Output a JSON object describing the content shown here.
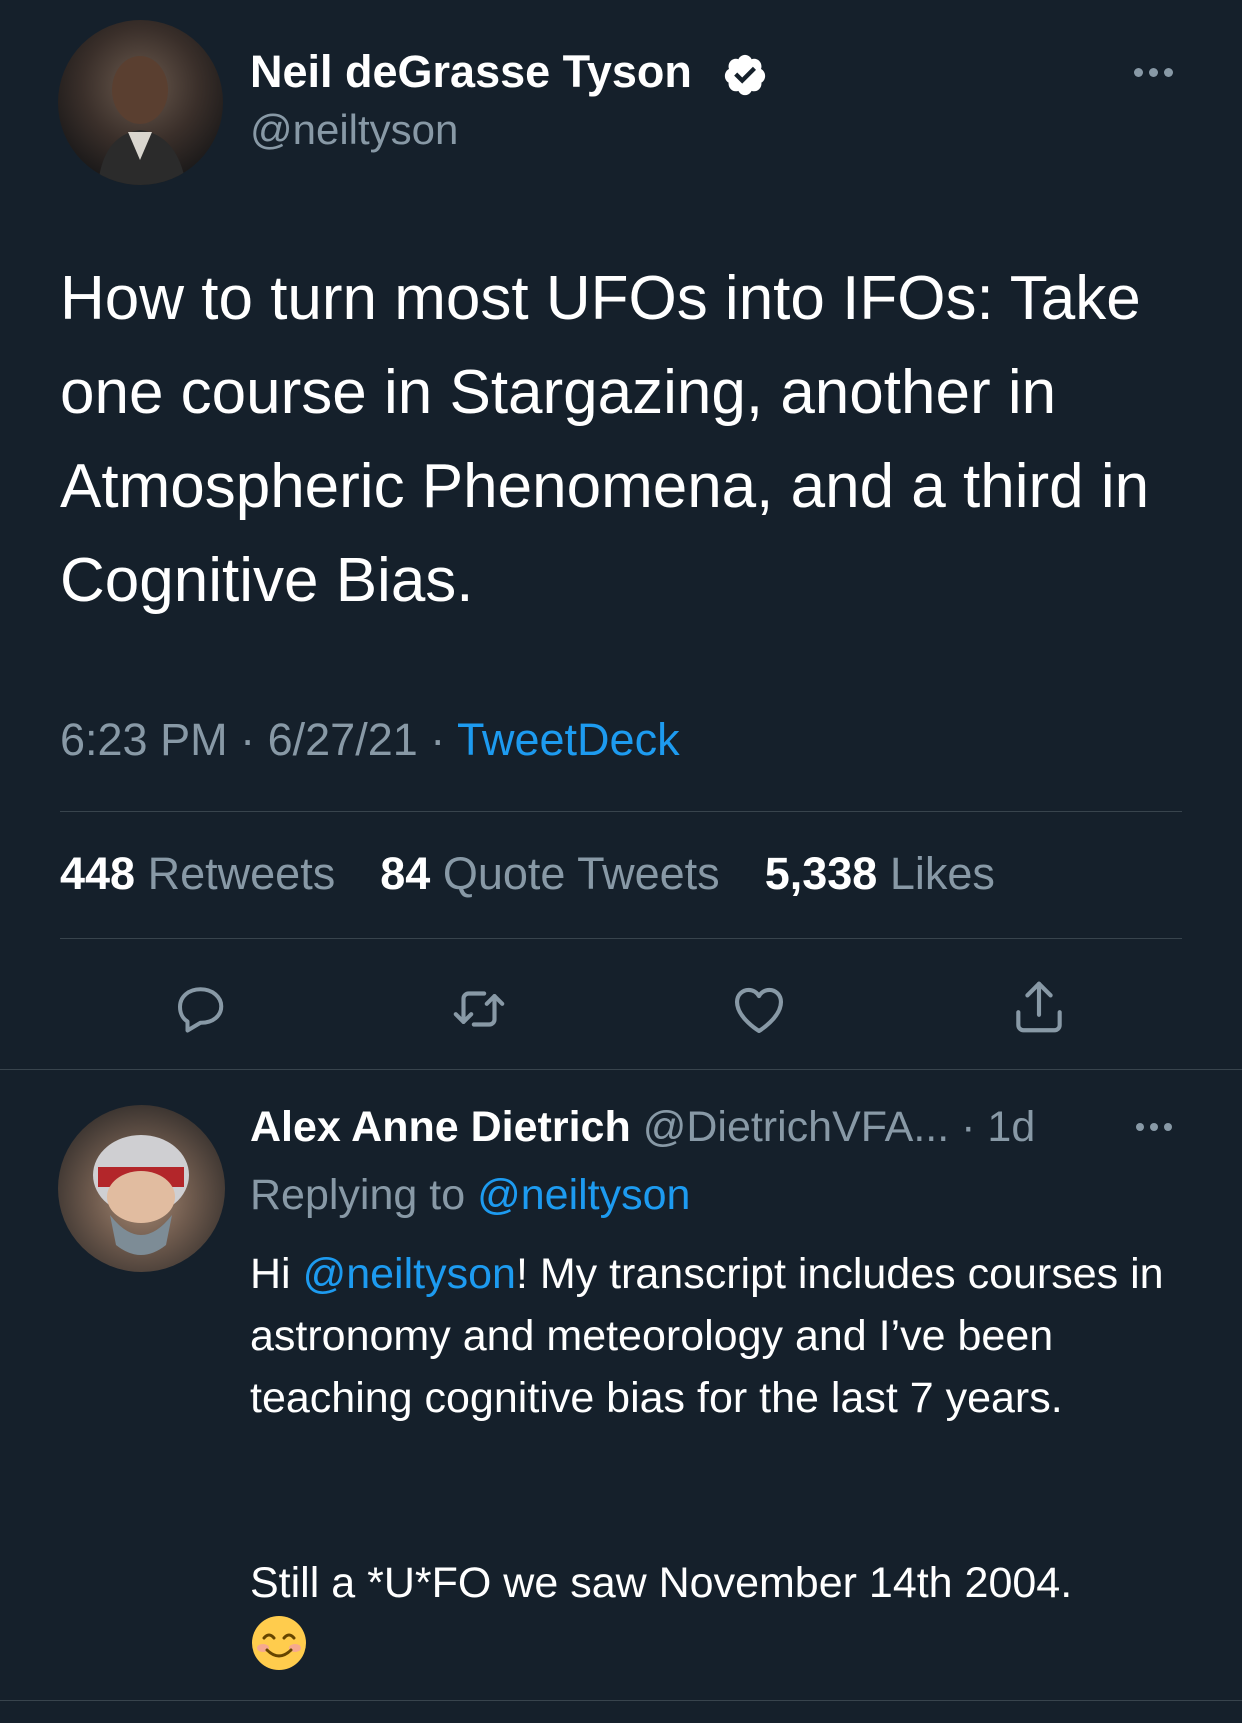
{
  "main_tweet": {
    "author_name": "Neil deGrasse Tyson",
    "handle": "@neiltyson",
    "text": "How to turn most UFOs into IFOs: Take one course in Stargazing, another in Atmospheric Phenomena, and a third in Cognitive Bias.",
    "time": "6:23 PM",
    "date": "6/27/21",
    "source": "TweetDeck",
    "separator": "·",
    "stats": {
      "retweets_count": "448",
      "retweets_label": "Retweets",
      "quotes_count": "84",
      "quotes_label": "Quote Tweets",
      "likes_count": "5,338",
      "likes_label": "Likes"
    }
  },
  "reply": {
    "author_name": "Alex Anne Dietrich",
    "handle": "@DietrichVFA...",
    "age": "· 1d",
    "replying_prefix": "Replying to",
    "replying_handle": "@neiltyson",
    "text_hi": "Hi ",
    "text_mention": "@neiltyson",
    "text_body": "! My transcript includes courses in astronomy and meteorology and I’ve been teaching cognitive bias for the last 7 years.",
    "text_second": "Still a *U*FO we saw November 14th 2004.",
    "emoji": "😊"
  },
  "colors": {
    "background": "#15202b",
    "accent": "#1d9bf0",
    "muted": "#8899a6",
    "divider": "#38444d"
  },
  "icons": [
    "verified-badge-icon",
    "more-icon",
    "reply-icon",
    "retweet-icon",
    "like-icon",
    "share-icon"
  ]
}
